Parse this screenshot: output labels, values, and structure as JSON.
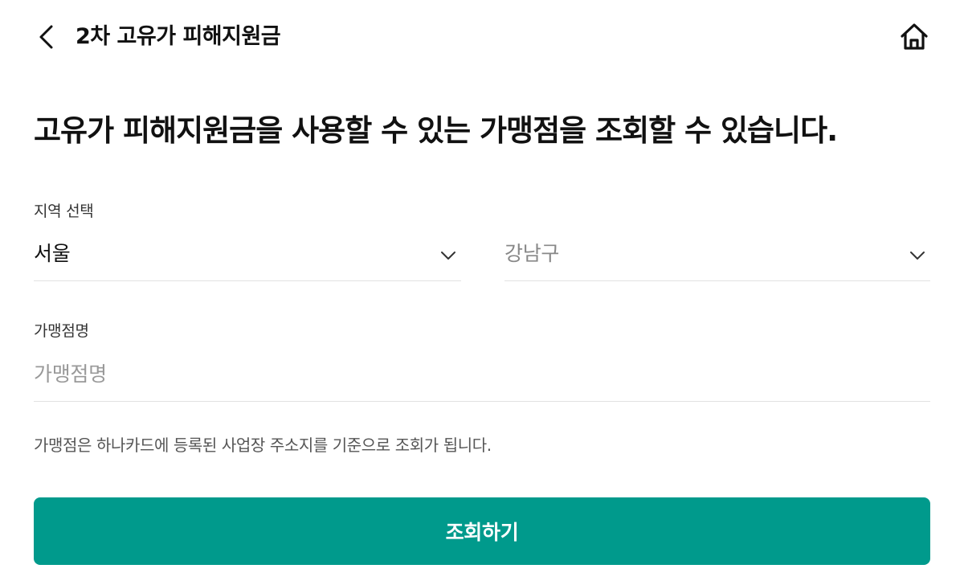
{
  "header": {
    "title": "2차 고유가 피해지원금",
    "back_icon": "chevron-left-icon",
    "home_icon": "home-icon"
  },
  "headline": "고유가 피해지원금을 사용할 수 있는 가맹점을 조회할 수 있습니다.",
  "region": {
    "label": "지역 선택",
    "city_value": "서울",
    "district_value": "강남구",
    "dropdown_icon": "chevron-down-icon"
  },
  "store": {
    "label": "가맹점명",
    "placeholder": "가맹점명",
    "value": ""
  },
  "notice": "가맹점은 하나카드에 등록된 사업장 주소지를 기준으로 조회가 됩니다.",
  "submit": {
    "label": "조회하기"
  },
  "colors": {
    "accent": "#009a8c",
    "text_primary": "#111111",
    "text_muted": "#888888",
    "divider": "#e2e2e2"
  }
}
